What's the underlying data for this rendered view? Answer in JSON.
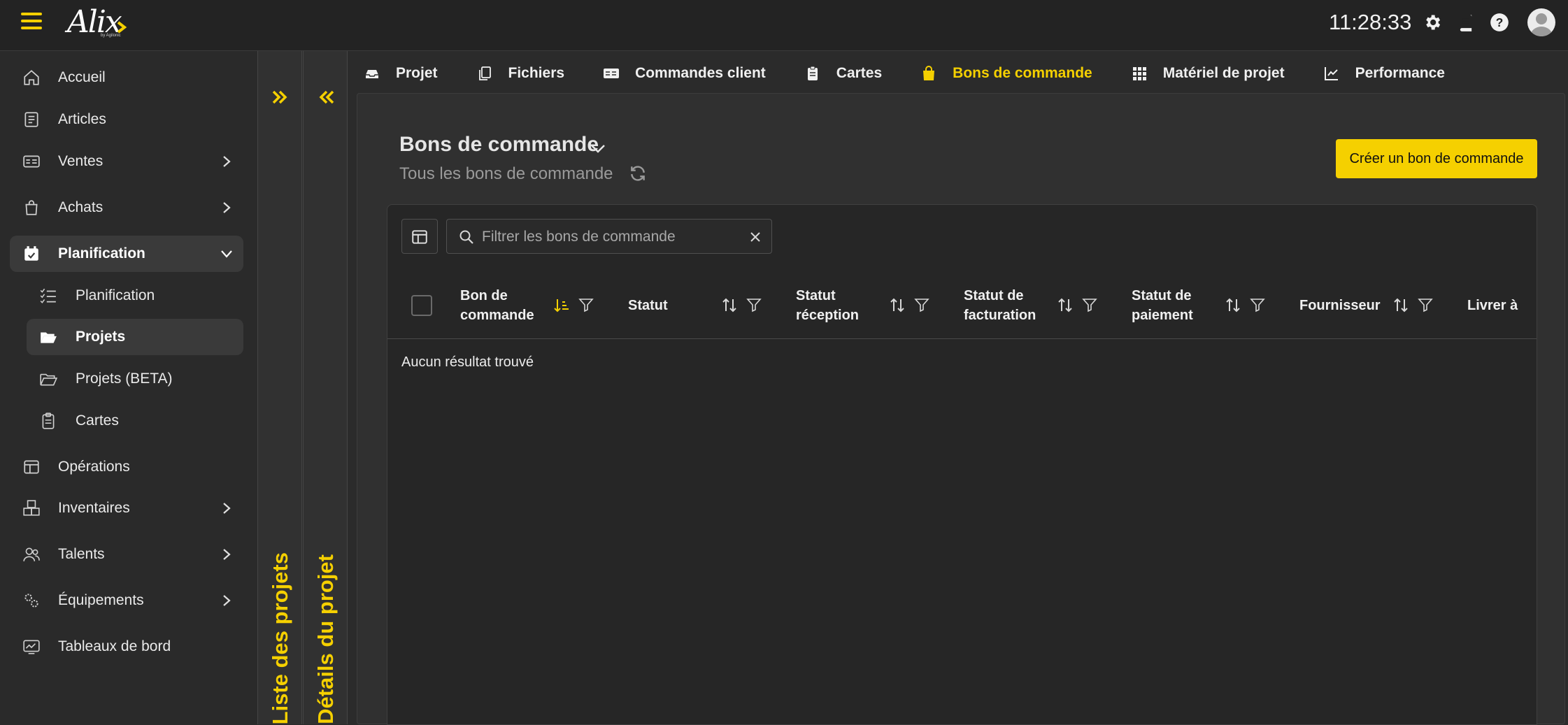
{
  "topbar": {
    "logo_text": "Alix",
    "logo_sub": "by Agilonic",
    "clock": "11:28:33"
  },
  "sidebar": {
    "items": [
      {
        "label": "Accueil",
        "icon": "home-icon"
      },
      {
        "label": "Articles",
        "icon": "book-icon"
      },
      {
        "label": "Ventes",
        "icon": "invoice-icon"
      },
      {
        "label": "Achats",
        "icon": "shopping-bag-icon"
      },
      {
        "label": "Planification",
        "icon": "calendar-check-icon"
      },
      {
        "label": "Opérations",
        "icon": "table-icon"
      },
      {
        "label": "Inventaires",
        "icon": "boxes-icon"
      },
      {
        "label": "Talents",
        "icon": "users-icon"
      },
      {
        "label": "Équipements",
        "icon": "gears-icon"
      },
      {
        "label": "Tableaux de bord",
        "icon": "dashboard-icon"
      }
    ],
    "sub_items": [
      {
        "label": "Planification",
        "icon": "list-check-icon"
      },
      {
        "label": "Projets",
        "icon": "folder-open-icon"
      },
      {
        "label": "Projets (BETA)",
        "icon": "folder-outline-icon"
      },
      {
        "label": "Cartes",
        "icon": "clipboard-icon"
      }
    ]
  },
  "panels": {
    "projects_label": "Liste des projets",
    "details_label": "Détails du projet"
  },
  "tabs": [
    {
      "label": "Projet",
      "icon": "inbox-icon"
    },
    {
      "label": "Fichiers",
      "icon": "copy-icon"
    },
    {
      "label": "Commandes client",
      "icon": "id-card-icon"
    },
    {
      "label": "Cartes",
      "icon": "clipboard-list-icon"
    },
    {
      "label": "Bons de commande",
      "icon": "shopping-bag-icon"
    },
    {
      "label": "Matériel de projet",
      "icon": "grid-icon"
    },
    {
      "label": "Performance",
      "icon": "chart-line-icon"
    }
  ],
  "main": {
    "title": "Bons de commande",
    "subtitle": "Tous les bons de commande",
    "create_button": "Créer un bon de commande",
    "search_placeholder": "Filtrer les bons de commande",
    "columns": [
      "Bon de\ncommande",
      "Statut",
      "Statut\nréception",
      "Statut de\nfacturation",
      "Statut de\npaiement",
      "Fournisseur",
      "Livrer à"
    ],
    "empty_message": "Aucun résultat trouvé"
  },
  "colors": {
    "accent": "#f5d000",
    "background": "#2b2b2b",
    "topbar": "#232323"
  }
}
